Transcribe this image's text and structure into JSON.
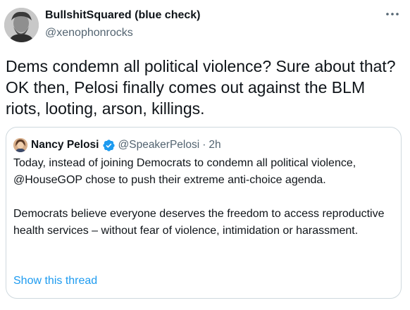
{
  "author": {
    "display_name": "BullshitSquared (blue check)",
    "handle": "@xenophonrocks"
  },
  "tweet": {
    "text": "Dems condemn all political violence? Sure about that? OK then, Pelosi finally comes out against the BLM riots, looting, arson, killings."
  },
  "quoted_tweet": {
    "display_name": "Nancy Pelosi",
    "handle": "@SpeakerPelosi",
    "separator": "·",
    "time": "2h",
    "paragraphs": [
      "Today, instead of joining Democrats to condemn all political violence, @HouseGOP chose to push their extreme anti-choice agenda.",
      "Democrats believe everyone deserves the freedom to access reproductive health services – without fear of violence, intimidation or harassment."
    ],
    "show_thread_label": "Show this thread"
  },
  "icons": {
    "more": "more-horizontal-icon",
    "verified": "verified-badge-icon"
  },
  "colors": {
    "accent": "#1d9bf0",
    "secondary_text": "#536471",
    "border": "#cfd9de"
  }
}
